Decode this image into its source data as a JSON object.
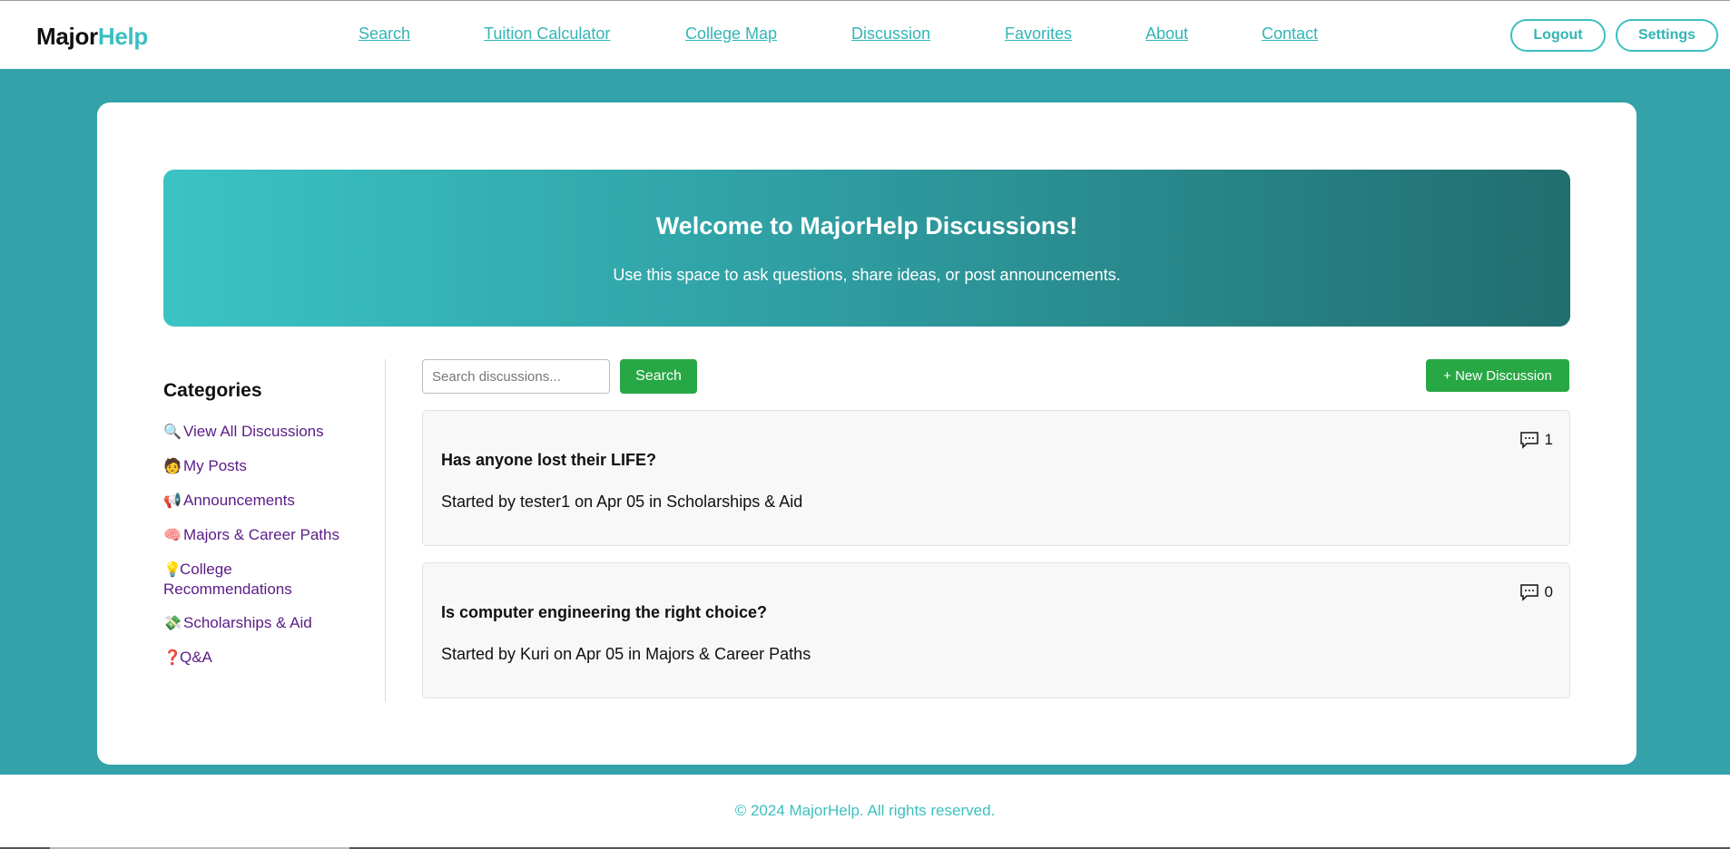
{
  "header": {
    "logo_part1": "Major",
    "logo_part2": "Help",
    "nav": [
      "Search",
      "Tuition Calculator",
      "College Map",
      "Discussion",
      "Favorites",
      "About",
      "Contact"
    ],
    "logout_label": "Logout",
    "settings_label": "Settings"
  },
  "hero": {
    "title": "Welcome to MajorHelp Discussions!",
    "subtitle": "Use this space to ask questions, share ideas, or post announcements."
  },
  "sidebar": {
    "heading": "Categories",
    "items": [
      {
        "icon": "magnifier-icon",
        "glyph": "🔍",
        "label": "View All Discussions"
      },
      {
        "icon": "person-icon",
        "glyph": "🧑",
        "label": "My Posts"
      },
      {
        "icon": "megaphone-icon",
        "glyph": "📢",
        "label": "Announcements"
      },
      {
        "icon": "brain-icon",
        "glyph": "🧠",
        "label": "Majors & Career Paths"
      },
      {
        "icon": "lightbulb-icon",
        "glyph": "💡",
        "label": "College Recommendations"
      },
      {
        "icon": "money-icon",
        "glyph": "💸",
        "label": "Scholarships & Aid"
      },
      {
        "icon": "question-icon",
        "glyph": "❓",
        "label": "Q&A"
      }
    ]
  },
  "search": {
    "placeholder": "Search discussions...",
    "button_label": "Search"
  },
  "new_discussion_label": "+ New Discussion",
  "posts": [
    {
      "title": "Has anyone lost their LIFE?",
      "meta": "Started by tester1 on Apr 05 in Scholarships & Aid",
      "comments": "1"
    },
    {
      "title": "Is computer engineering the right choice?",
      "meta": "Started by Kuri on Apr 05 in Majors & Career Paths",
      "comments": "0"
    }
  ],
  "footer": {
    "text": "© 2024 MajorHelp. All rights reserved."
  },
  "colors": {
    "accent": "#3bbfbf",
    "background": "#33a3a9",
    "button_green": "#28a745",
    "category_link": "#5a1c86"
  }
}
